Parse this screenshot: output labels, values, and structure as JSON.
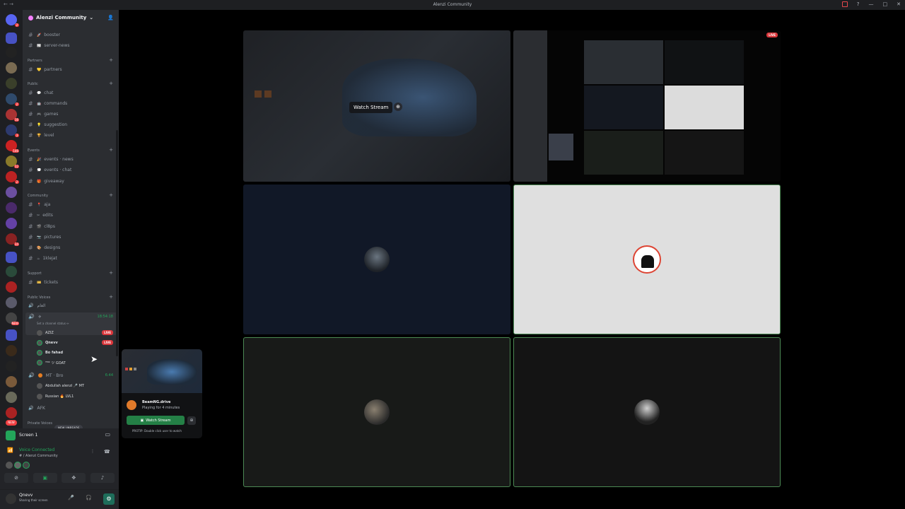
{
  "window": {
    "title": "Alenzi Community"
  },
  "server": {
    "name": "Alenzi Community"
  },
  "guild_badges": [
    "2",
    "2",
    "16",
    "3",
    "146",
    "32",
    "2",
    "34",
    "NEW"
  ],
  "channels": [
    {
      "name": "booster",
      "emoji": "🚀"
    },
    {
      "name": "server-news",
      "emoji": "📰"
    }
  ],
  "categories": [
    {
      "name": "Partners",
      "channels": [
        {
          "name": "partners",
          "emoji": "💛"
        }
      ]
    },
    {
      "name": "Public",
      "channels": [
        {
          "name": "chat",
          "emoji": "💬"
        },
        {
          "name": "commands",
          "emoji": "🤖"
        },
        {
          "name": "games",
          "emoji": "🎮"
        },
        {
          "name": "suggestion",
          "emoji": "💡"
        },
        {
          "name": "level",
          "emoji": "🏆"
        }
      ]
    },
    {
      "name": "Events",
      "channels": [
        {
          "name": "events · news",
          "emoji": "🎉"
        },
        {
          "name": "events · chat",
          "emoji": "💭"
        },
        {
          "name": "giveaway",
          "emoji": "🎁"
        }
      ]
    },
    {
      "name": "Community",
      "channels": [
        {
          "name": "aja",
          "emoji": "📍"
        },
        {
          "name": "edits",
          "emoji": "✂"
        },
        {
          "name": "cl8ps",
          "emoji": "🎬"
        },
        {
          "name": "pictures",
          "emoji": "📷"
        },
        {
          "name": "designs",
          "emoji": "🎨"
        },
        {
          "name": "1klejat",
          "emoji": "☕"
        }
      ]
    },
    {
      "name": "Support",
      "channels": [
        {
          "name": "tickets",
          "emoji": "🎫"
        }
      ]
    },
    {
      "name": "Public Voices",
      "channels": []
    }
  ],
  "voice": {
    "channel_top": "العام",
    "active_channel": {
      "timer": "18:54:18",
      "status_hint": "Set a channel status ✏"
    },
    "users": [
      {
        "name": "AZIZ",
        "live": true
      },
      {
        "name": "Qnevv",
        "live": true
      },
      {
        "name": "Bo fahad",
        "live": false
      },
      {
        "name": "ᵀᴹᴷ ツ GOAT",
        "live": false
      }
    ],
    "second_channel": {
      "name": "MT · Bro",
      "timer": "6:44",
      "users": [
        "Abdullah alenzi 🎤 MT",
        "Russian 🔥 LVL1"
      ]
    },
    "afk": "AFK",
    "private_category": "Private Voices"
  },
  "live_label": "LIVE",
  "new_unreads": "NEW UNREADS",
  "screen_share": {
    "label": "Screen 1"
  },
  "voice_connected": {
    "title": "Voice Connected",
    "sub": "# / Alenzi Community"
  },
  "user": {
    "name": "Qnevv",
    "status": "Sharing their screen"
  },
  "stage": {
    "watch_stream": "Watch Stream"
  },
  "popup": {
    "game": "BeamNG.drive",
    "playing": "Playing for 4 minutes",
    "button": "Watch Stream",
    "protip": "PROTIP: Double click user to watch"
  },
  "colors": {
    "green": "#23a55a",
    "live_red": "#da373c",
    "speaking": "#4c8a54"
  }
}
